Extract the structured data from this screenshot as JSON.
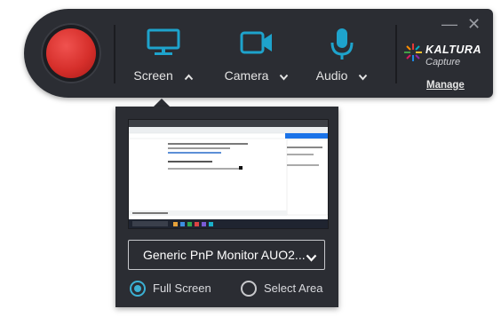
{
  "toolbar": {
    "record_button": "record",
    "tools": [
      {
        "label": "Screen",
        "icon": "monitor-icon",
        "caret": "chevron-up-icon"
      },
      {
        "label": "Camera",
        "icon": "camera-icon",
        "caret": "chevron-down-icon"
      },
      {
        "label": "Audio",
        "icon": "microphone-icon",
        "caret": "chevron-down-icon"
      }
    ],
    "window_controls": {
      "minimize": "—",
      "close": "✕"
    },
    "brand": {
      "name": "KALTURA",
      "sub": "Capture"
    },
    "manage_label": "Manage"
  },
  "panel": {
    "display_select": {
      "value": "Generic PnP Monitor AUO2..."
    },
    "radios": [
      {
        "label": "Full Screen",
        "selected": true
      },
      {
        "label": "Select Area",
        "selected": false
      }
    ]
  },
  "colors": {
    "accent": "#3bb0d3",
    "bg": "#2b2d33",
    "record": "#d62f2b"
  }
}
